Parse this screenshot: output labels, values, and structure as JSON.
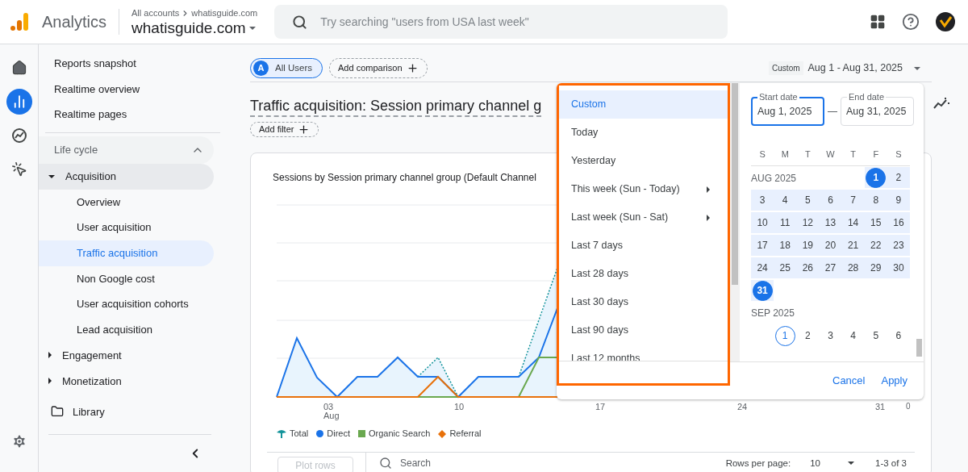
{
  "header": {
    "product": "Analytics",
    "breadcrumb": [
      "All accounts",
      "whatisguide.com"
    ],
    "property": "whatisguide.com",
    "search": {
      "placeholder": "Try searching \"users from USA last week\""
    }
  },
  "rail": [
    {
      "kind": "home",
      "selected": false
    },
    {
      "kind": "reports",
      "selected": true
    },
    {
      "kind": "explore",
      "selected": false
    },
    {
      "kind": "advertising",
      "selected": false
    }
  ],
  "nav": {
    "items": [
      {
        "kind": "link",
        "label": "Reports snapshot",
        "selected": false
      },
      {
        "kind": "link",
        "label": "Realtime overview",
        "selected": false
      },
      {
        "kind": "link",
        "label": "Realtime pages",
        "selected": false
      },
      {
        "kind": "section",
        "label": "Life cycle",
        "expanded": true,
        "children": [
          {
            "kind": "group",
            "label": "Acquisition",
            "expanded": true,
            "children": [
              {
                "label": "Overview",
                "selected": false
              },
              {
                "label": "User acquisition",
                "selected": false
              },
              {
                "label": "Traffic acquisition",
                "selected": true
              },
              {
                "label": "Non Google cost",
                "selected": false
              },
              {
                "label": "User acquisition cohorts",
                "selected": false
              },
              {
                "label": "Lead acquisition",
                "selected": false
              }
            ]
          },
          {
            "kind": "group",
            "label": "Engagement",
            "expanded": false
          },
          {
            "kind": "group",
            "label": "Monetization",
            "expanded": false
          }
        ]
      },
      {
        "kind": "folder",
        "label": "Library"
      }
    ]
  },
  "toolbar": {
    "segment": {
      "badge": "A",
      "label": "All Users"
    },
    "add_comparison": "Add comparison",
    "date_range": {
      "preset": "Custom",
      "range": "Aug 1 - Aug 31, 2025"
    }
  },
  "report": {
    "title": "Traffic acquisition: Session primary channel g",
    "add_filter": "Add filter"
  },
  "chart": {
    "title": "Sessions by Session primary channel group (Default Channel",
    "x_labels": [
      "03",
      "10",
      "17",
      "24",
      "31"
    ],
    "x_month": "Aug",
    "y_label": "0",
    "legend": [
      {
        "kind": "total",
        "label": "Total",
        "color": "#12939a"
      },
      {
        "kind": "direct",
        "label": "Direct",
        "color": "#1a73e8"
      },
      {
        "kind": "organic",
        "label": "Organic Search",
        "color": "#6aa84f"
      },
      {
        "kind": "referral",
        "label": "Referral",
        "color": "#e8710a"
      }
    ]
  },
  "table_toolbar": {
    "plot_rows": {
      "label": "Plot rows",
      "disabled": true
    },
    "search": {
      "placeholder": "Search"
    },
    "rows_per_page": {
      "label": "Rows per page:",
      "value": "10"
    },
    "pagination": "1-3 of 3"
  },
  "date_picker": {
    "presets": [
      {
        "label": "Custom",
        "selected": true,
        "submenu": false
      },
      {
        "label": "Today",
        "selected": false,
        "submenu": false
      },
      {
        "label": "Yesterday",
        "selected": false,
        "submenu": false
      },
      {
        "label": "This week (Sun - Today)",
        "selected": false,
        "submenu": true
      },
      {
        "label": "Last week (Sun - Sat)",
        "selected": false,
        "submenu": true
      },
      {
        "label": "Last 7 days",
        "selected": false,
        "submenu": false
      },
      {
        "label": "Last 28 days",
        "selected": false,
        "submenu": false
      },
      {
        "label": "Last 30 days",
        "selected": false,
        "submenu": false
      },
      {
        "label": "Last 90 days",
        "selected": false,
        "submenu": false
      },
      {
        "label": "Last 12 months",
        "selected": false,
        "submenu": false
      }
    ],
    "start": {
      "label": "Start date",
      "value": "Aug 1, 2025",
      "focused": true
    },
    "end": {
      "label": "End date",
      "value": "Aug 31, 2025",
      "focused": false
    },
    "weekdays": [
      "S",
      "M",
      "T",
      "W",
      "T",
      "F",
      "S"
    ],
    "months": [
      {
        "label": "AUG 2025",
        "weeks": [
          [
            {
              "kind": "blank"
            },
            {
              "kind": "blank"
            },
            {
              "kind": "blank"
            },
            {
              "kind": "blank"
            },
            {
              "kind": "blank"
            },
            {
              "kind": "day",
              "day": "1",
              "in_range": true,
              "selected": true,
              "today": false
            },
            {
              "kind": "day",
              "day": "2",
              "in_range": true,
              "selected": false,
              "today": false
            }
          ],
          [
            {
              "kind": "day",
              "day": "3",
              "in_range": true,
              "selected": false,
              "today": false
            },
            {
              "kind": "day",
              "day": "4",
              "in_range": true,
              "selected": false,
              "today": false
            },
            {
              "kind": "day",
              "day": "5",
              "in_range": true,
              "selected": false,
              "today": false
            },
            {
              "kind": "day",
              "day": "6",
              "in_range": true,
              "selected": false,
              "today": false
            },
            {
              "kind": "day",
              "day": "7",
              "in_range": true,
              "selected": false,
              "today": false
            },
            {
              "kind": "day",
              "day": "8",
              "in_range": true,
              "selected": false,
              "today": false
            },
            {
              "kind": "day",
              "day": "9",
              "in_range": true,
              "selected": false,
              "today": false
            }
          ],
          [
            {
              "kind": "day",
              "day": "10",
              "in_range": true,
              "selected": false,
              "today": false
            },
            {
              "kind": "day",
              "day": "11",
              "in_range": true,
              "selected": false,
              "today": false
            },
            {
              "kind": "day",
              "day": "12",
              "in_range": true,
              "selected": false,
              "today": false
            },
            {
              "kind": "day",
              "day": "13",
              "in_range": true,
              "selected": false,
              "today": false
            },
            {
              "kind": "day",
              "day": "14",
              "in_range": true,
              "selected": false,
              "today": false
            },
            {
              "kind": "day",
              "day": "15",
              "in_range": true,
              "selected": false,
              "today": false
            },
            {
              "kind": "day",
              "day": "16",
              "in_range": true,
              "selected": false,
              "today": false
            }
          ],
          [
            {
              "kind": "day",
              "day": "17",
              "in_range": true,
              "selected": false,
              "today": false
            },
            {
              "kind": "day",
              "day": "18",
              "in_range": true,
              "selected": false,
              "today": false
            },
            {
              "kind": "day",
              "day": "19",
              "in_range": true,
              "selected": false,
              "today": false
            },
            {
              "kind": "day",
              "day": "20",
              "in_range": true,
              "selected": false,
              "today": false
            },
            {
              "kind": "day",
              "day": "21",
              "in_range": true,
              "selected": false,
              "today": false
            },
            {
              "kind": "day",
              "day": "22",
              "in_range": true,
              "selected": false,
              "today": false
            },
            {
              "kind": "day",
              "day": "23",
              "in_range": true,
              "selected": false,
              "today": false
            }
          ],
          [
            {
              "kind": "day",
              "day": "24",
              "in_range": true,
              "selected": false,
              "today": false
            },
            {
              "kind": "day",
              "day": "25",
              "in_range": true,
              "selected": false,
              "today": false
            },
            {
              "kind": "day",
              "day": "26",
              "in_range": true,
              "selected": false,
              "today": false
            },
            {
              "kind": "day",
              "day": "27",
              "in_range": true,
              "selected": false,
              "today": false
            },
            {
              "kind": "day",
              "day": "28",
              "in_range": true,
              "selected": false,
              "today": false
            },
            {
              "kind": "day",
              "day": "29",
              "in_range": true,
              "selected": false,
              "today": false
            },
            {
              "kind": "day",
              "day": "30",
              "in_range": true,
              "selected": false,
              "today": false
            }
          ],
          [
            {
              "kind": "day",
              "day": "31",
              "in_range": true,
              "selected": true,
              "today": false
            }
          ]
        ]
      },
      {
        "label": "SEP 2025",
        "weeks": [
          [
            {
              "kind": "blank"
            },
            {
              "kind": "day",
              "day": "1",
              "in_range": false,
              "selected": false,
              "today": true
            },
            {
              "kind": "day",
              "day": "2",
              "in_range": false,
              "selected": false,
              "today": false
            },
            {
              "kind": "day",
              "day": "3",
              "in_range": false,
              "selected": false,
              "today": false
            },
            {
              "kind": "day",
              "day": "4",
              "in_range": false,
              "selected": false,
              "today": false
            },
            {
              "kind": "day",
              "day": "5",
              "in_range": false,
              "selected": false,
              "today": false
            },
            {
              "kind": "day",
              "day": "6",
              "in_range": false,
              "selected": false,
              "today": false
            }
          ]
        ]
      }
    ],
    "actions": [
      "Cancel",
      "Apply"
    ]
  }
}
